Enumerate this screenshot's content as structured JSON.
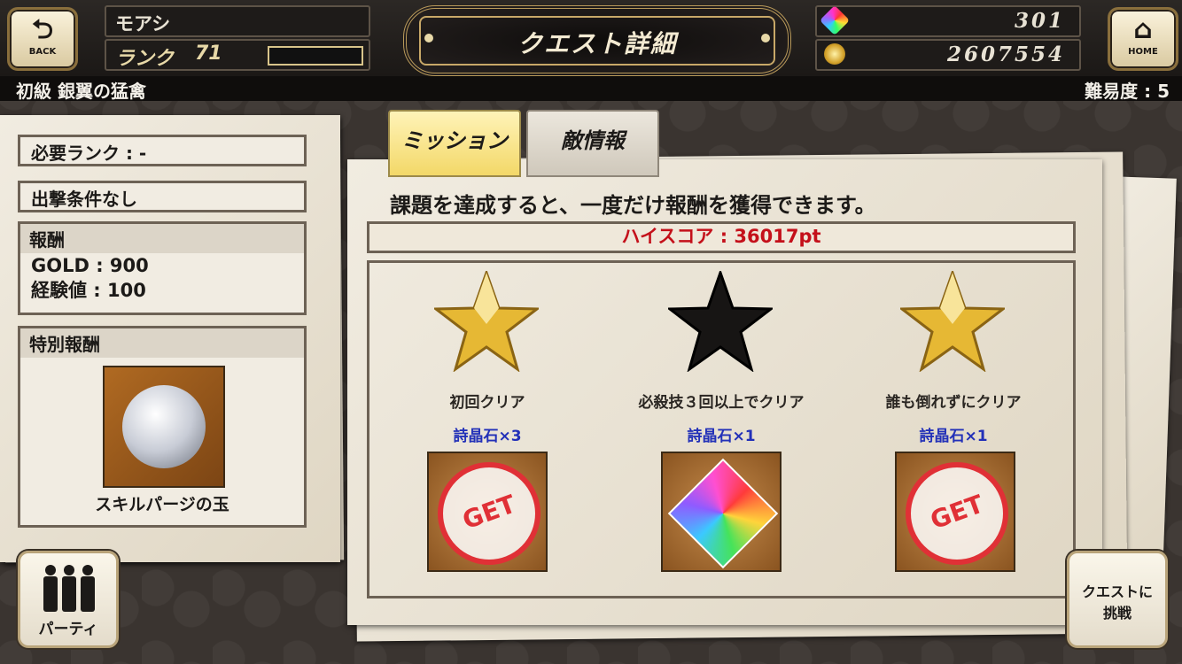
{
  "header": {
    "back_label": "BACK",
    "home_label": "HOME",
    "player_name": "モアシ",
    "rank_label": "ランク",
    "rank_value": "71",
    "title": "クエスト詳細",
    "gems": "301",
    "gold": "2607554"
  },
  "quest": {
    "name": "初級 銀翼の猛禽",
    "difficulty": "難易度 : 5"
  },
  "left_panel": {
    "required_rank": "必要ランク : -",
    "sortie_condition": "出撃条件なし",
    "reward_head": "報酬",
    "reward_gold": "GOLD : 900",
    "reward_exp": "経験値 : 100",
    "special_reward_head": "特別報酬",
    "special_reward_item": "スキルパージの玉"
  },
  "tabs": {
    "mission": "ミッション",
    "enemy_info": "敵情報"
  },
  "mission_panel": {
    "description": "課題を達成すると、一度だけ報酬を獲得できます。",
    "high_score": "ハイスコア : 36017pt",
    "missions": [
      {
        "label": "初回クリア",
        "reward": "詩晶石×3",
        "star": "gold",
        "status": "GET"
      },
      {
        "label": "必殺技３回以上でクリア",
        "reward": "詩晶石×1",
        "star": "black",
        "status": ""
      },
      {
        "label": "誰も倒れずにクリア",
        "reward": "詩晶石×1",
        "star": "gold",
        "status": "GET"
      }
    ]
  },
  "buttons": {
    "party": "パーティ",
    "challenge_line1": "クエストに",
    "challenge_line2": "挑戦"
  },
  "colors": {
    "high_score": "#c4101a",
    "reward_text": "#2230b8",
    "tab_active": "#f3d868"
  },
  "icons": {
    "back": "back-arrow-icon",
    "home": "home-icon",
    "gem": "rainbow-gem-icon",
    "coin": "gold-coin-icon",
    "party": "party-members-icon"
  }
}
